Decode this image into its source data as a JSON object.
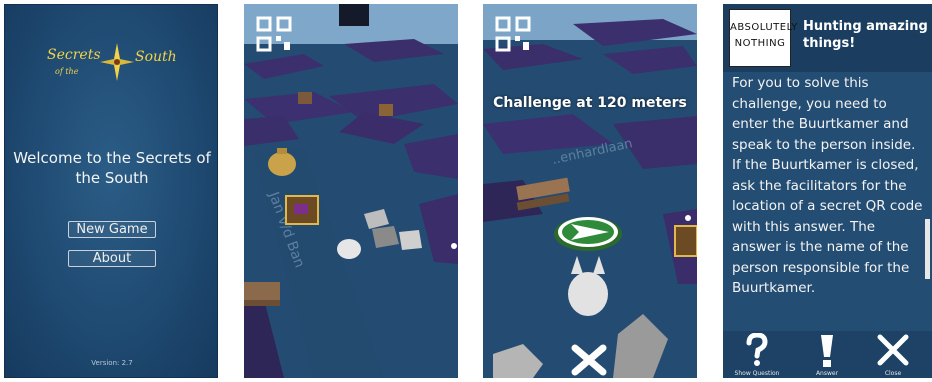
{
  "menu": {
    "logo_line1": "Secrets",
    "logo_line2": "of the",
    "logo_line3": "South",
    "welcome": "Welcome to the Secrets of the South",
    "new_game": "New Game",
    "about": "About",
    "version": "Version: 2.7"
  },
  "map_view": {
    "street_label_1": "Jan v/d Ban",
    "street_label_2": "..enhardlaan"
  },
  "challenge_view": {
    "challenge_text": "Challenge at 120 meters"
  },
  "question": {
    "badge": "ABSOLUTELY NOTHING",
    "title": "Hunting amazing things!",
    "body": "For you to solve this challenge, you need to enter the Buurtkamer and speak to the person inside. If the Buurtkamer is closed, ask the facilitators for the location of a secret QR code with this answer. The answer is the name of the person responsible for the Buurtkamer.",
    "show_question": "Show Question",
    "answer": "Answer",
    "close": "Close"
  },
  "colors": {
    "menu_bg": "#1f4a72",
    "accent_gold": "#f1d24a",
    "map_ground": "#254d73",
    "building": "#3b2f6e",
    "question_bg": "#244d73"
  }
}
